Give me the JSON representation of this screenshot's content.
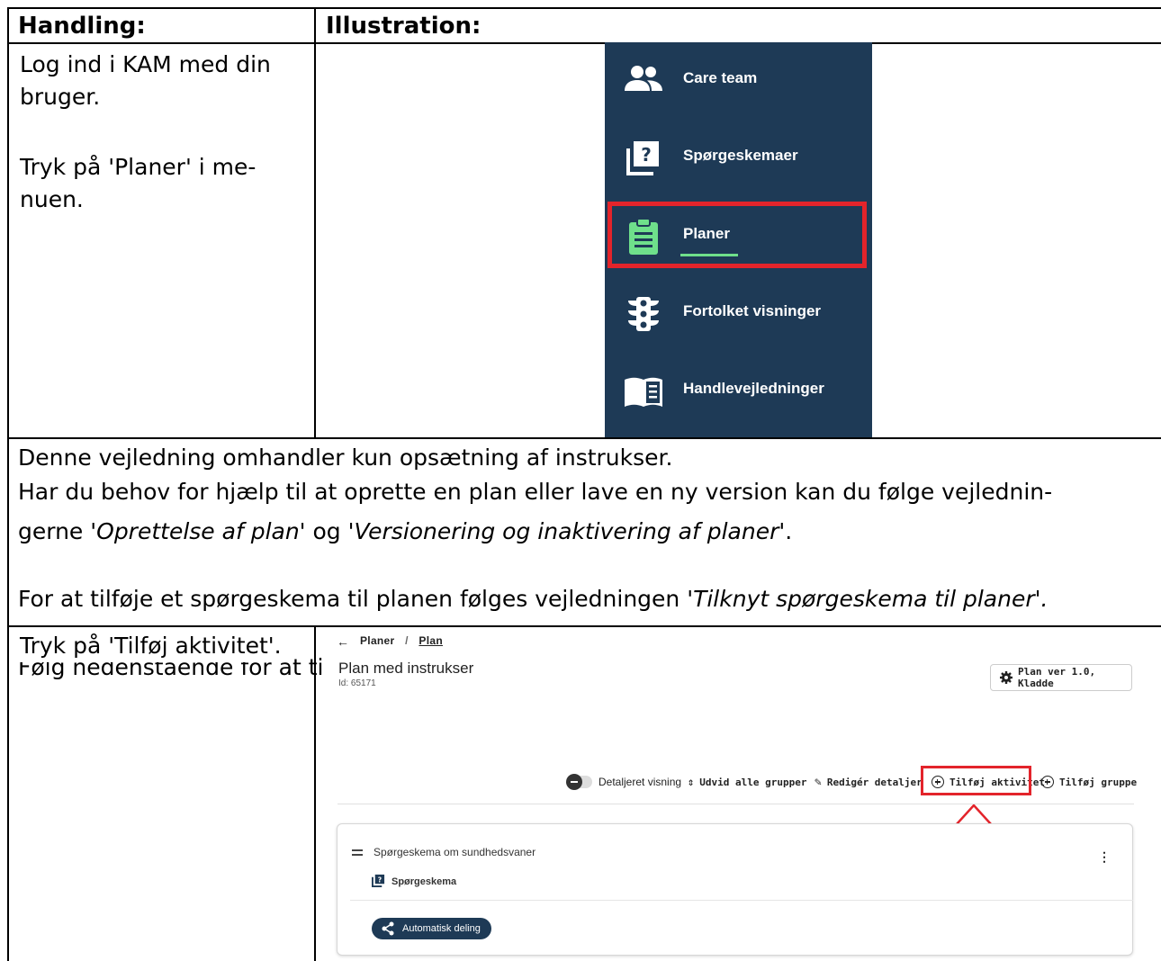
{
  "table": {
    "col1_header": "Handling:",
    "col2_header": "Illustration:"
  },
  "step1": {
    "line1": "Log ind i KAM med din",
    "line2": "bruger.",
    "line3": "Tryk på 'Planer' i me-",
    "line4": "nuen."
  },
  "sidebar": {
    "items": [
      {
        "label": "Care team",
        "icon": "people-icon"
      },
      {
        "label": "Spørgeskemaer",
        "icon": "questionnaire-icon"
      },
      {
        "label": "Planer",
        "icon": "clipboard-icon",
        "active": true
      },
      {
        "label": "Fortolket visninger",
        "icon": "traffic-light-icon"
      },
      {
        "label": "Handlevejledninger",
        "icon": "book-icon"
      }
    ],
    "colors": {
      "background": "#1e3a56",
      "highlight": "#e3242b",
      "active_icon": "#6fe08b"
    }
  },
  "info": {
    "line1": "Denne vejledning omhandler kun opsætning af instrukser.",
    "line2": "Har du behov for hjælp til at oprette en plan eller lave en ny version kan du følge vejlednin-",
    "line3_pre": "gerne ",
    "line3_it1": "'Oprettelse af plan'",
    "line3_mid": " og ",
    "line3_it2": "'Versionering og inaktivering af planer'",
    "line3_post": ".",
    "line4_pre": "For at tilføje et spørgeskema til planen følges vejledningen ",
    "line4_it": "'Tilknyt spørgeskema til planer'.",
    "line5": "Følg nedenstående for at tilføje instrukser."
  },
  "step2": {
    "text": "Tryk på 'Tilføj aktivitet'."
  },
  "app": {
    "breadcrumb": {
      "root": "Planer",
      "sep": "/",
      "current": "Plan"
    },
    "title": "Plan med instrukser",
    "id_label": "Id: 65171",
    "version_button": "Plan ver 1.0, Kladde",
    "toolbar": {
      "detail_view": "Detaljeret visning",
      "expand_groups": "Udvid alle grupper",
      "edit_details": "Redigér detaljer",
      "add_activity": "Tilføj aktivitet",
      "add_group": "Tilføj gruppe"
    },
    "card": {
      "title": "Spørgeskema om sundhedsvaner",
      "type": "Spørgeskema",
      "chip": "Automatisk deling"
    }
  }
}
